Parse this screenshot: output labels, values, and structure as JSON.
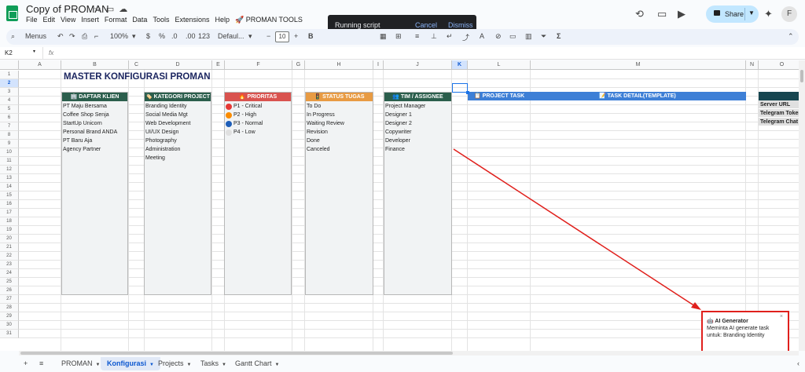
{
  "doc": {
    "title": "Copy of PROMAN",
    "menus": [
      "File",
      "Edit",
      "View",
      "Insert",
      "Format",
      "Data",
      "Tools",
      "Extensions",
      "Help",
      "🚀 PROMAN TOOLS"
    ]
  },
  "toast": {
    "message": "Running script",
    "cancel": "Cancel",
    "dismiss": "Dismiss"
  },
  "topright": {
    "share": "Share",
    "avatar": "F"
  },
  "toolbar": {
    "menus": "Menus",
    "zoom": "100%",
    "currency": "$",
    "percent": "%",
    "dec_less": ".0",
    "dec_more": ".00",
    "num_format": "123",
    "font": "Defaul...",
    "font_size": "10",
    "minus": "−",
    "plus": "+",
    "bold": "B",
    "sigma": "Σ"
  },
  "formula_bar": {
    "cell_ref": "K2",
    "fx": "fx",
    "value": ""
  },
  "grid": {
    "columns": [
      "A",
      "B",
      "C",
      "D",
      "E",
      "F",
      "G",
      "H",
      "I",
      "J",
      "K",
      "L",
      "M",
      "N",
      "O"
    ],
    "rows": [
      "1",
      "2",
      "3",
      "4",
      "5",
      "6",
      "7",
      "8",
      "9",
      "10",
      "11",
      "12",
      "13",
      "14",
      "15",
      "16",
      "17",
      "18",
      "19",
      "20",
      "21",
      "22",
      "23",
      "24",
      "25",
      "26",
      "27",
      "28",
      "29",
      "30",
      "31"
    ],
    "master_title": "MASTER KONFIGURASI PROMAN"
  },
  "panels": {
    "klien": {
      "header": "🏢 DAFTAR KLIEN",
      "color": "#2b5e4c",
      "items": [
        "PT Maju Bersama",
        "Coffee Shop Senja",
        "StartUp Unicorn",
        "Personal Brand ANDA",
        "PT Baru Aja",
        "Agency Partner"
      ]
    },
    "kategori": {
      "header": "🏷️ KATEGORI PROJECT",
      "color": "#2b5e4c",
      "items": [
        "Branding Identity",
        "Social Media Mgt",
        "Web Development",
        "UI/UX Design",
        "Photography",
        "Administration",
        "Meeting"
      ]
    },
    "prioritas": {
      "header": "🔥 PRIORITAS",
      "color": "#d9534f",
      "items": [
        "P1 - Critical",
        "P2 - High",
        "P3 - Normal",
        "P4 - Low"
      ],
      "dot_colors": [
        "#e53935",
        "#fb8c00",
        "#1e5eb8",
        "#e0e0e0"
      ]
    },
    "status": {
      "header": "🚦 STATUS TUGAS",
      "color": "#e89b43",
      "items": [
        "To Do",
        "In Progress",
        "Waiting Review",
        "Revision",
        "Done",
        "Canceled"
      ]
    },
    "tim": {
      "header": "👥 TIM / ASSIGNEE",
      "color": "#2b5e4c",
      "items": [
        "Project Manager",
        "Designer 1",
        "Designer 2",
        "Copywriter",
        "Developer",
        "Finance"
      ]
    }
  },
  "task_bar": {
    "project_task": "📋 PROJECT TASK",
    "task_detail": "📝 TASK DETAIL(TEMPLATE)"
  },
  "config": {
    "rows": [
      "Server URL",
      "Telegram Token",
      "Telegram Chat ID"
    ]
  },
  "ai_popup": {
    "title": "🤖 AI Generator",
    "body": "Meminta AI generate task untuk: Branding Identity",
    "close": "×"
  },
  "sheet_tabs": {
    "add": "+",
    "list": "≡",
    "tabs": [
      "PROMAN",
      "Konfigurasi",
      "Projects",
      "Tasks",
      "Gantt Chart"
    ],
    "active": "Konfigurasi"
  }
}
